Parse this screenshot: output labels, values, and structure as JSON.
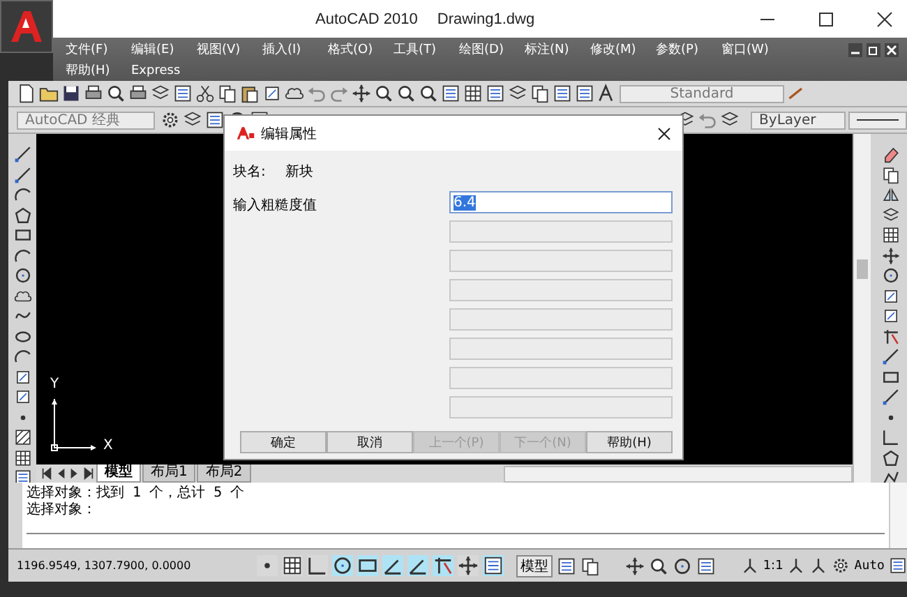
{
  "window": {
    "title": "AutoCAD 2010",
    "document": "Drawing1.dwg"
  },
  "menu_rows": [
    [
      "文件(F)",
      "编辑(E)",
      "视图(V)",
      "插入(I)",
      "格式(O)",
      "工具(T)",
      "绘图(D)",
      "标注(N)",
      "修改(M)",
      "参数(P)",
      "窗口(W)"
    ],
    [
      "帮助(H)",
      "Express"
    ]
  ],
  "toolbar": {
    "text_style": "Standard"
  },
  "workspace": {
    "value": "AutoCAD 经典"
  },
  "properties": {
    "current": "ByLayer"
  },
  "ucs": {
    "y_label": "Y",
    "x_label": "X"
  },
  "layout_tabs": [
    {
      "label": "模型",
      "selected": true
    },
    {
      "label": "布局1",
      "selected": false
    },
    {
      "label": "布局2",
      "selected": false
    }
  ],
  "command_lines": [
    "选择对象：找到 1 个，总计 5 个",
    "选择对象："
  ],
  "status_bar": {
    "coordinates": "1196.9549, 1307.7900, 0.0000",
    "toggles": [
      {
        "on": false
      },
      {
        "on": false
      },
      {
        "on": false
      },
      {
        "on": true
      },
      {
        "on": true
      },
      {
        "on": true
      },
      {
        "on": true
      },
      {
        "on": true
      },
      {
        "on": false
      },
      {
        "on": true
      }
    ],
    "space": "模型",
    "annotation_scale": "1:1",
    "workspace": "Auto"
  },
  "dialog": {
    "title": "编辑属性",
    "block_label": "块名:",
    "block_name": "新块",
    "prompt": "输入粗糙度值",
    "fields": [
      {
        "value": "6.4",
        "disabled": false,
        "highlighted": true
      },
      {
        "disabled": true
      },
      {
        "disabled": true
      },
      {
        "disabled": true
      },
      {
        "disabled": true
      },
      {
        "disabled": true
      },
      {
        "disabled": true
      },
      {
        "disabled": true
      }
    ],
    "buttons": [
      {
        "label": "确定",
        "disabled": false
      },
      {
        "label": "取消",
        "disabled": false
      },
      {
        "label": "上一个(P)",
        "disabled": true
      },
      {
        "label": "下一个(N)",
        "disabled": true
      },
      {
        "label": "帮助(H)",
        "disabled": false
      }
    ]
  }
}
